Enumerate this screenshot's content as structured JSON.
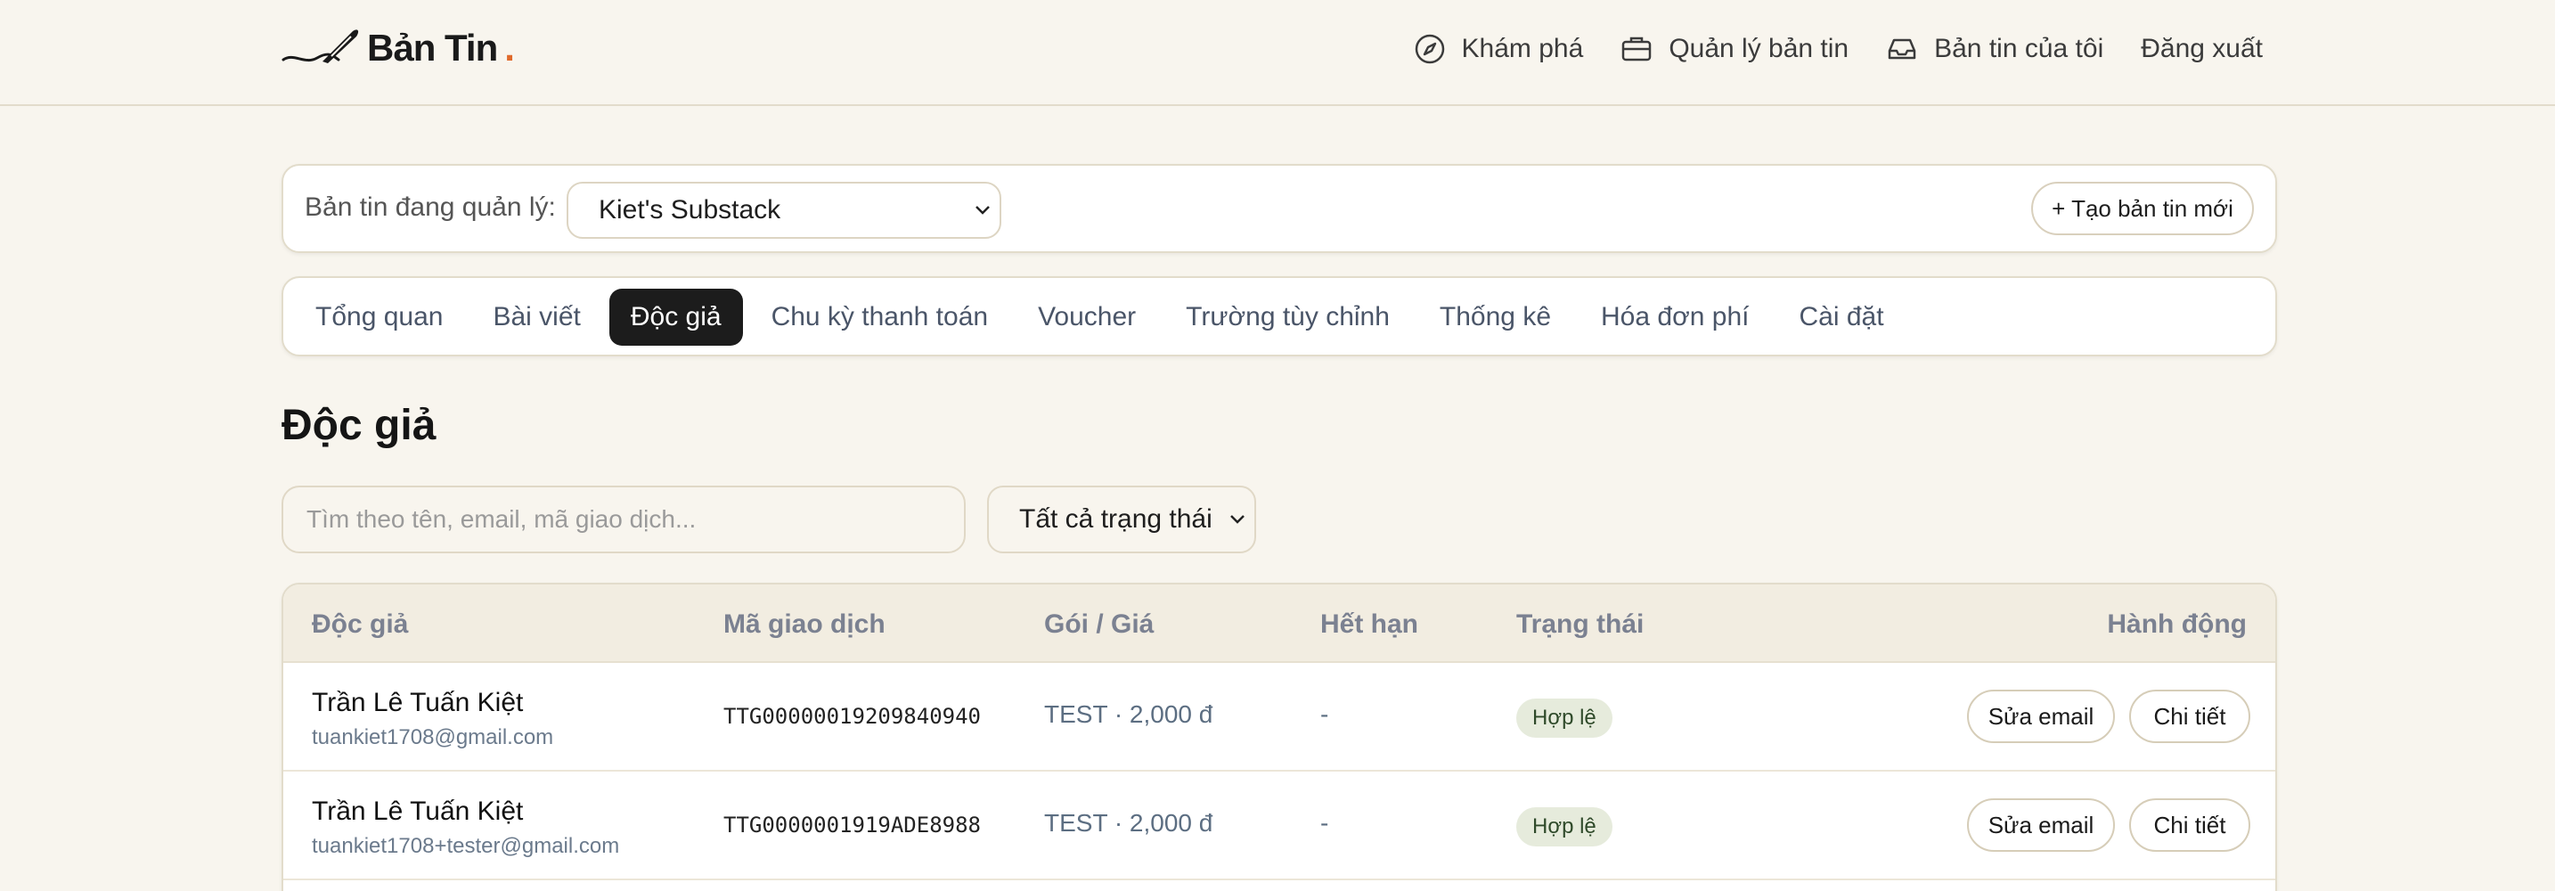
{
  "brand": {
    "name": "Bản Tin",
    "dot": ".",
    "accent": "#e06a2b"
  },
  "nav": {
    "explore": "Khám phá",
    "manage": "Quản lý bản tin",
    "mine": "Bản tin của tôi",
    "logout": "Đăng xuất"
  },
  "manage": {
    "label": "Bản tin đang quản lý:",
    "selected": "Kiet's Substack",
    "new_button": "+ Tạo bản tin mới"
  },
  "tabs": [
    {
      "label": "Tổng quan",
      "active": false
    },
    {
      "label": "Bài viết",
      "active": false
    },
    {
      "label": "Độc giả",
      "active": true
    },
    {
      "label": "Chu kỳ thanh toán",
      "active": false
    },
    {
      "label": "Voucher",
      "active": false
    },
    {
      "label": "Trường tùy chỉnh",
      "active": false
    },
    {
      "label": "Thống kê",
      "active": false
    },
    {
      "label": "Hóa đơn phí",
      "active": false
    },
    {
      "label": "Cài đặt",
      "active": false
    }
  ],
  "page": {
    "title": "Độc giả"
  },
  "filters": {
    "search_placeholder": "Tìm theo tên, email, mã giao dịch...",
    "status_selected": "Tất cả trạng thái"
  },
  "table": {
    "headers": {
      "reader": "Độc giả",
      "txn": "Mã giao dịch",
      "plan": "Gói / Giá",
      "expiry": "Hết hạn",
      "status": "Trạng thái",
      "actions": "Hành động"
    },
    "rows": [
      {
        "name": "Trần Lê Tuấn Kiệt",
        "email": "tuankiet1708@gmail.com",
        "txn": "TTG00000019209840940",
        "plan": "TEST · 2,000 đ",
        "expiry": "-",
        "status": "Hợp lệ",
        "edit": "Sửa email",
        "detail": "Chi tiết"
      },
      {
        "name": "Trần Lê Tuấn Kiệt",
        "email": "tuankiet1708+tester@gmail.com",
        "txn": "TTG0000001919ADE8988",
        "plan": "TEST · 2,000 đ",
        "expiry": "-",
        "status": "Hợp lệ",
        "edit": "Sửa email",
        "detail": "Chi tiết"
      }
    ]
  }
}
